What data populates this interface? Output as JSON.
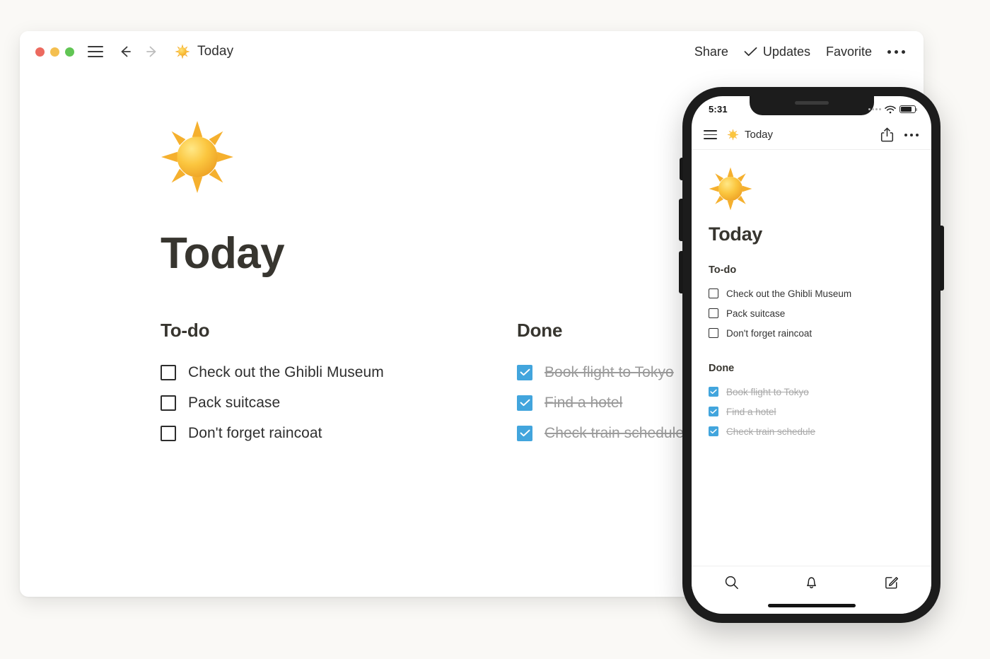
{
  "desktop": {
    "titlebar": {
      "traffic_lights": [
        "close",
        "minimize",
        "maximize"
      ],
      "menu_icon": "hamburger-icon",
      "back_icon": "arrow-left-icon",
      "forward_icon": "arrow-right-icon",
      "doc_emoji": "sun-emoji",
      "doc_title": "Today",
      "share_label": "Share",
      "updates_label": "Updates",
      "updates_check_icon": "check-icon",
      "favorite_label": "Favorite",
      "more_icon": "ellipsis-icon"
    },
    "page": {
      "emoji": "sun-emoji",
      "title": "Today",
      "sections": [
        {
          "heading": "To-do",
          "tasks": [
            {
              "label": "Check out the Ghibli Museum",
              "checked": false
            },
            {
              "label": "Pack suitcase",
              "checked": false
            },
            {
              "label": "Don't forget raincoat",
              "checked": false
            }
          ]
        },
        {
          "heading": "Done",
          "tasks": [
            {
              "label": "Book flight to Tokyo",
              "checked": true
            },
            {
              "label": "Find a hotel",
              "checked": true
            },
            {
              "label": "Check train schedule",
              "checked": true
            }
          ]
        }
      ]
    }
  },
  "phone": {
    "status_bar": {
      "time": "5:31",
      "signal_icon": "cellular-signal-icon",
      "wifi_icon": "wifi-icon",
      "battery_icon": "battery-icon"
    },
    "appbar": {
      "menu_icon": "hamburger-icon",
      "doc_emoji": "sun-emoji",
      "doc_title": "Today",
      "share_icon": "share-icon",
      "more_icon": "ellipsis-icon"
    },
    "page": {
      "emoji": "sun-emoji",
      "title": "Today",
      "sections": [
        {
          "heading": "To-do",
          "tasks": [
            {
              "label": "Check out the Ghibli Museum",
              "checked": false
            },
            {
              "label": "Pack suitcase",
              "checked": false
            },
            {
              "label": "Don't forget raincoat",
              "checked": false
            }
          ]
        },
        {
          "heading": "Done",
          "tasks": [
            {
              "label": "Book flight to Tokyo",
              "checked": true
            },
            {
              "label": "Find a hotel",
              "checked": true
            },
            {
              "label": "Check train schedule",
              "checked": true
            }
          ]
        }
      ]
    },
    "tabbar": [
      {
        "icon": "search-icon"
      },
      {
        "icon": "bell-icon"
      },
      {
        "icon": "compose-icon"
      }
    ]
  },
  "colors": {
    "background": "#faf9f6",
    "surface": "#ffffff",
    "text": "#37352f",
    "muted_text": "#9b9b9b",
    "checkbox_checked": "#42a5dd",
    "traffic_red": "#ec6a5f",
    "traffic_yellow": "#f4bf50",
    "traffic_green": "#61c554",
    "phone_frame": "#1c1c1c"
  }
}
